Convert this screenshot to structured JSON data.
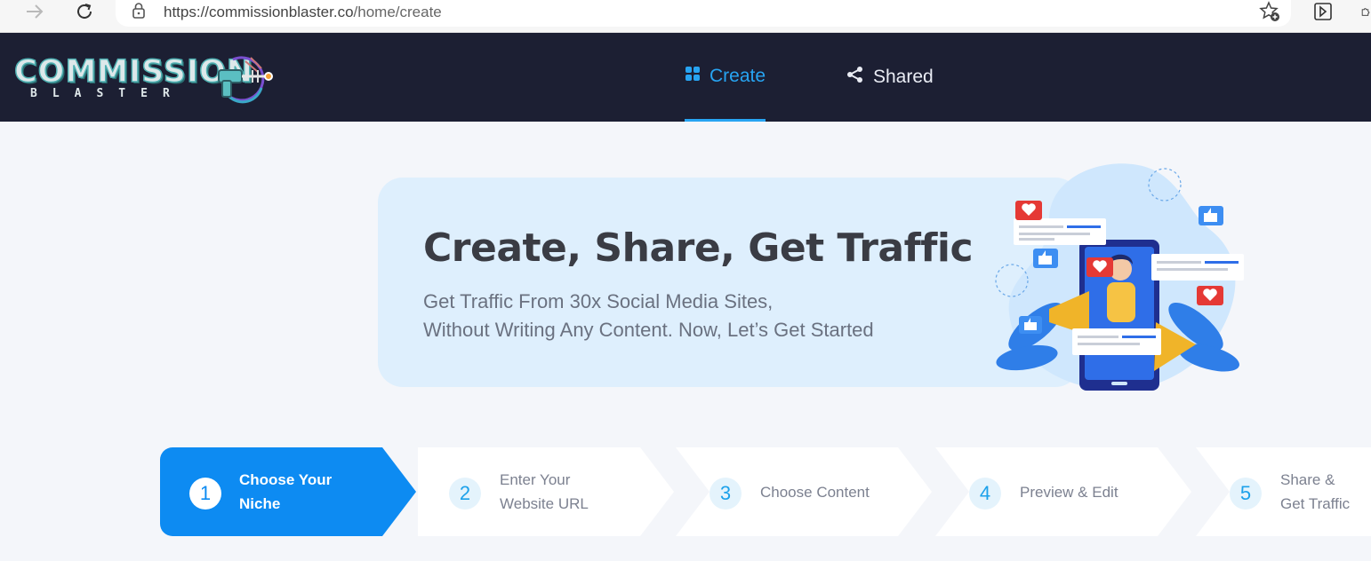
{
  "browser": {
    "url_host": "https://commissionblaster.co",
    "url_path": "/home/create"
  },
  "header": {
    "logo_main": "COMMISSION",
    "logo_sub": "BLASTER",
    "tabs": [
      {
        "label": "Create",
        "active": true,
        "icon": "grid-icon"
      },
      {
        "label": "Shared",
        "active": false,
        "icon": "share-icon"
      }
    ],
    "accent_color": "#27a4f2",
    "background_color": "#1c1f33"
  },
  "hero": {
    "title": "Create, Share, Get Traffic",
    "subtitle_line1": "Get Traffic From 30x Social Media Sites,",
    "subtitle_line2": "Without Writing Any Content. Now, Let’s Get Started"
  },
  "steps": [
    {
      "number": "1",
      "line1": "Choose Your",
      "line2": "Niche",
      "active": true
    },
    {
      "number": "2",
      "line1": "Enter Your",
      "line2": "Website URL",
      "active": false
    },
    {
      "number": "3",
      "line1": "Choose Content",
      "line2": "",
      "active": false
    },
    {
      "number": "4",
      "line1": "Preview & Edit",
      "line2": "",
      "active": false
    },
    {
      "number": "5",
      "line1": "Share &",
      "line2": "Get Traffic",
      "active": false
    }
  ],
  "colors": {
    "active_step": "#0d8bf2",
    "page_background": "#f4f6fa",
    "hero_background": "#deeffd"
  }
}
